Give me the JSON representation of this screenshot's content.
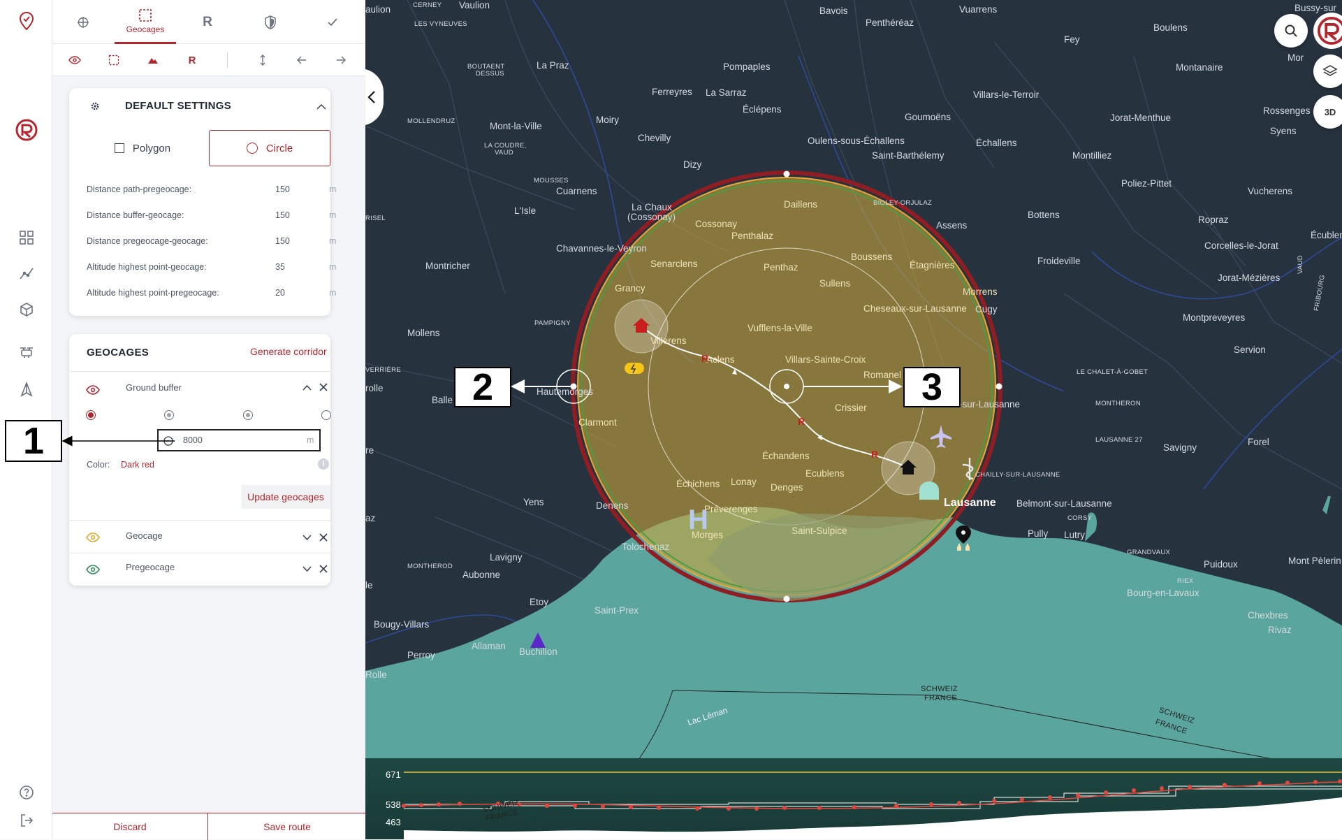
{
  "top_tabs": [
    {
      "id": "crosshair",
      "label": ""
    },
    {
      "id": "geocages",
      "label": "Geocages"
    },
    {
      "id": "r",
      "label": "R"
    },
    {
      "id": "shield",
      "label": ""
    },
    {
      "id": "check",
      "label": ""
    }
  ],
  "subtoolbar": {
    "r_label": "R"
  },
  "default_settings": {
    "title": "DEFAULT SETTINGS",
    "polygon_label": "Polygon",
    "circle_label": "Circle",
    "rows": [
      {
        "label": "Distance path-pregeocage:",
        "value": "150",
        "unit": "m"
      },
      {
        "label": "Distance buffer-geocage:",
        "value": "150",
        "unit": "m"
      },
      {
        "label": "Distance pregeocage-geocage:",
        "value": "150",
        "unit": "m"
      },
      {
        "label": "Altitude highest point-geocage:",
        "value": "35",
        "unit": "m"
      },
      {
        "label": "Altitude highest point-pregeocage:",
        "value": "20",
        "unit": "m"
      }
    ]
  },
  "geocages": {
    "title": "GEOCAGES",
    "generate_label": "Generate corridor",
    "ground_buffer": {
      "name": "Ground buffer",
      "radius_value": "8000",
      "radius_unit": "m",
      "color_label": "Color:",
      "color_value": "Dark red",
      "update_label": "Update geocages"
    },
    "items": [
      {
        "name": "Geocage",
        "eye_color": "#e0a82e"
      },
      {
        "name": "Pregeocage",
        "eye_color": "#2e8b57"
      }
    ]
  },
  "bottom": {
    "discard": "Discard",
    "save": "Save route"
  },
  "map": {
    "buttons": {
      "three_d": "3D"
    },
    "places": {
      "vaulion": "Vaulion",
      "aulion": "aulion",
      "cerney": "CERNEY",
      "les_vyneuves": "LES VYNEUVES",
      "bavois": "Bavois",
      "vuarrens": "Vuarrens",
      "bussy": "Bussy-sur",
      "penthereaz": "Penthéréaz",
      "fey": "Fey",
      "boulens": "Boulens",
      "praz": "La Praz",
      "bouta": "BOUTAENT",
      "dessus": "DESSUS",
      "pompaples": "Pompaples",
      "mor": "Mor",
      "montanaire": "Montanaire",
      "ferreyres": "Ferreyres",
      "sarraz": "La Sarraz",
      "eclepens": "Éclépens",
      "villars_terroir": "Villars-le-Terroir",
      "jorat_menthue": "Jorat-Menthue",
      "rossenges": "Rossenges",
      "syens": "Syens",
      "mollendruz": "MOLLENDRUZ",
      "mont_ville": "Mont-la-Ville",
      "moiry": "Moiry",
      "goumoens": "Goumoëns",
      "chevilly": "Chevilly",
      "oulens": "Oulens-sous-Échallens",
      "echallens": "Échallens",
      "coudre": "LA COUDRE,",
      "vaud_s": "VAUD",
      "st_barth": "Saint-Barthélemy",
      "montilliez": "Montilliez",
      "dizy": "Dizy",
      "poliez": "Poliez-Pittet",
      "mousses": "MOUSSES",
      "cuarnens": "Cuarnens",
      "daillens": "Daillens",
      "bioley": "BIOLEY-ORJULAZ",
      "assens": "Assens",
      "vucherens": "Vucherens",
      "lisle": "L'Isle",
      "chaux": "La Chaux",
      "cossonay_city": "(Cossonay)",
      "cossonay": "Cossonay",
      "bottens": "Bottens",
      "echoub": "Écublen",
      "isel": "RISEL",
      "penthalaz": "Penthalaz",
      "ropraz": "Ropraz",
      "chavannes": "Chavannes-le-Veyron",
      "corcelles": "Corcelles-le-Jorat",
      "froideville": "Froideville",
      "boussens": "Boussens",
      "montricher": "Montricher",
      "senarclens": "Senarclens",
      "penthaz": "Penthaz",
      "etagnieres": "Étagnières",
      "jorat_mez": "Jorat-Mézières",
      "vaud": "VAUD",
      "fribourg": "FRIBOURG",
      "sullens": "Sullens",
      "grancy": "Grancy",
      "morrens": "Morrens",
      "cugy": "Cugy",
      "cheseaux": "Cheseaux-sur-Lausanne",
      "montprev": "Montpreveyres",
      "pampigny": "PAMPIGNY",
      "vufflens": "Vufflens-la-Ville",
      "mollens": "Mollens",
      "villerens": "Villerens",
      "servion": "Servion",
      "aclens": "Aclens",
      "villars_ste": "Villars-Sainte-Croix",
      "verriere": "VERRIÈRE",
      "chalet": "LE CHALET-À-GOBET",
      "romanel": "Romanel",
      "rolle_top": "rolle",
      "balle": "Balle",
      "hautemorges": "Hautemorges",
      "sur_lausanne": "-sur-Lausanne",
      "crissier": "Crissier",
      "montheron": "MONTHERON",
      "clarmont": "Clarmont",
      "lausanne27": "LAUSANNE 27",
      "savigny": "Savigny",
      "forel": "Forel",
      "re": "re",
      "echandens": "Échandens",
      "ecublens": "Ecublens",
      "chailly": "CHAILLY-SUR-LAUSANNE",
      "echichens": "Échichens",
      "lonay": "Lonay",
      "denges": "Denges",
      "yens": "Yens",
      "denens": "Denens",
      "preverenges": "Préverenges",
      "lausanne": "Lausanne",
      "belmont": "Belmont-sur-Lausanne",
      "corsy": "CORSY",
      "az": "az",
      "morges": "Morges",
      "st_sulpice": "Saint-Sulpice",
      "pully": "Pully",
      "lutry": "Lutry",
      "tolochenaz": "Tolochenaz",
      "lavigny": "Lavigny",
      "grandvaux": "GRANDVAUX",
      "puidoux": "Puidoux",
      "mont_pelerin": "Mont Pèlerin",
      "montherod": "MONTHEROD",
      "riex": "RIEX",
      "aubonne": "Aubonne",
      "le": "le",
      "bourg": "Bourg-en-Lavaux",
      "etoy": "Etoy",
      "chexbres": "Chexbres",
      "st_prex": "Saint-Prex",
      "rivaz": "Rivaz",
      "bougy": "Bougy-Villars",
      "allaman": "Allaman",
      "buchillon": "Buchillon",
      "perroy": "Perroy",
      "rolle": "Rolle",
      "schweiz1": "SCHWEIZ",
      "france1": "FRANCE",
      "lac_leman": "Lac Léman",
      "schweiz2": "SCHWEIZ",
      "france2": "FRANCE",
      "schweiz3": "SCHWEIZ",
      "france3": "FRANCE"
    },
    "pois": {
      "r1": "R",
      "r2": "R",
      "r3": "R",
      "heli": "H"
    }
  },
  "callouts": {
    "one": "1",
    "two": "2",
    "three": "3"
  },
  "elevation_profile": {
    "labels": {
      "top": "671",
      "mid": "538",
      "low": "463"
    }
  },
  "colors": {
    "accent": "#b3262e",
    "geocage_fill": "#c9a53a",
    "buffer_ring": "#8f1d24",
    "lake": "#5aa59d",
    "map_bg": "#27323f"
  }
}
